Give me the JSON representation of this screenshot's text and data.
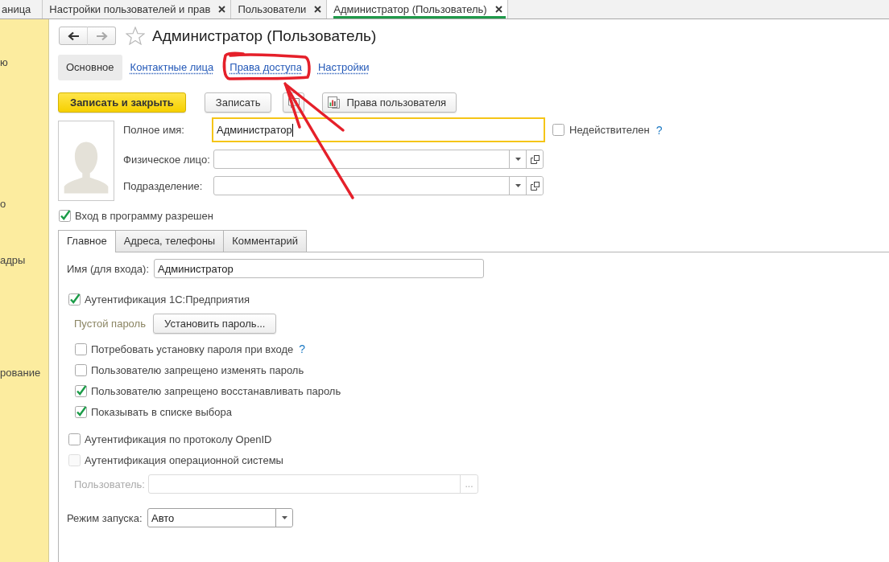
{
  "open_tabs": [
    {
      "label": "аница",
      "closable": false,
      "selected": false
    },
    {
      "label": "Настройки пользователей и прав",
      "closable": true,
      "selected": false
    },
    {
      "label": "Пользователи",
      "closable": true,
      "selected": false
    },
    {
      "label": "Администратор (Пользователь)",
      "closable": true,
      "selected": true
    }
  ],
  "sidebar": {
    "items": [
      "ю",
      "о",
      "адры",
      "рование"
    ]
  },
  "nav": [
    {
      "kind": "back",
      "disabled": false
    },
    {
      "kind": "forward",
      "disabled": true
    }
  ],
  "starred": false,
  "title": "Администратор (Пользователь)",
  "sections": [
    {
      "label": "Основное",
      "selected": true
    },
    {
      "label": "Контактные лица",
      "selected": false
    },
    {
      "label": "Права доступа",
      "selected": false
    },
    {
      "label": "Настройки",
      "selected": false
    }
  ],
  "actions": [
    {
      "kind": "primary",
      "label": "Записать и закрыть"
    },
    {
      "kind": "default",
      "label": "Записать"
    },
    {
      "kind": "comment"
    },
    {
      "kind": "report",
      "label": "Права пользователя"
    }
  ],
  "fields": [
    {
      "kind": "text",
      "label": "Полное имя:",
      "value": "Администратор",
      "focused": true
    },
    {
      "kind": "select",
      "label": "Физическое лицо:"
    },
    {
      "kind": "select",
      "label": "Подразделение:"
    }
  ],
  "inactive": {
    "label": "Недействителен",
    "checked": false,
    "help": "?"
  },
  "login_allowed": {
    "label": "Вход в программу разрешен",
    "checked": true
  },
  "tabs": [
    {
      "label": "Главное",
      "selected": true
    },
    {
      "label": "Адреса, телефоны",
      "selected": false
    },
    {
      "label": "Комментарий",
      "selected": false
    }
  ],
  "login_name": {
    "label": "Имя (для входа):",
    "value": "Администратор"
  },
  "auth": [
    {
      "kind": "checkbox",
      "label": "Аутентификация 1С:Предприятия",
      "checked": true,
      "disabled": false,
      "children": [
        {
          "kind": "password",
          "status": "Пустой пароль",
          "button": "Установить пароль..."
        },
        {
          "kind": "checkbox",
          "label": "Потребовать установку пароля при входе",
          "checked": false,
          "disabled": false,
          "help": "?"
        },
        {
          "kind": "checkbox",
          "label": "Пользователю запрещено изменять пароль",
          "checked": false,
          "disabled": false
        },
        {
          "kind": "checkbox",
          "label": "Пользователю запрещено восстанавливать пароль",
          "checked": true,
          "disabled": false
        },
        {
          "kind": "checkbox",
          "label": "Показывать в списке выбора",
          "checked": true,
          "disabled": false
        }
      ]
    },
    {
      "kind": "checkbox",
      "label": "Аутентификация по протоколу OpenID",
      "checked": false,
      "disabled": false
    },
    {
      "kind": "checkbox",
      "label": "Аутентификация операционной системы",
      "checked": false,
      "disabled": true,
      "children": [
        {
          "kind": "field",
          "label": "Пользователь:",
          "button": "...",
          "disabled": true
        }
      ]
    }
  ],
  "launch_mode": {
    "label": "Режим запуска:",
    "value": "Авто"
  }
}
